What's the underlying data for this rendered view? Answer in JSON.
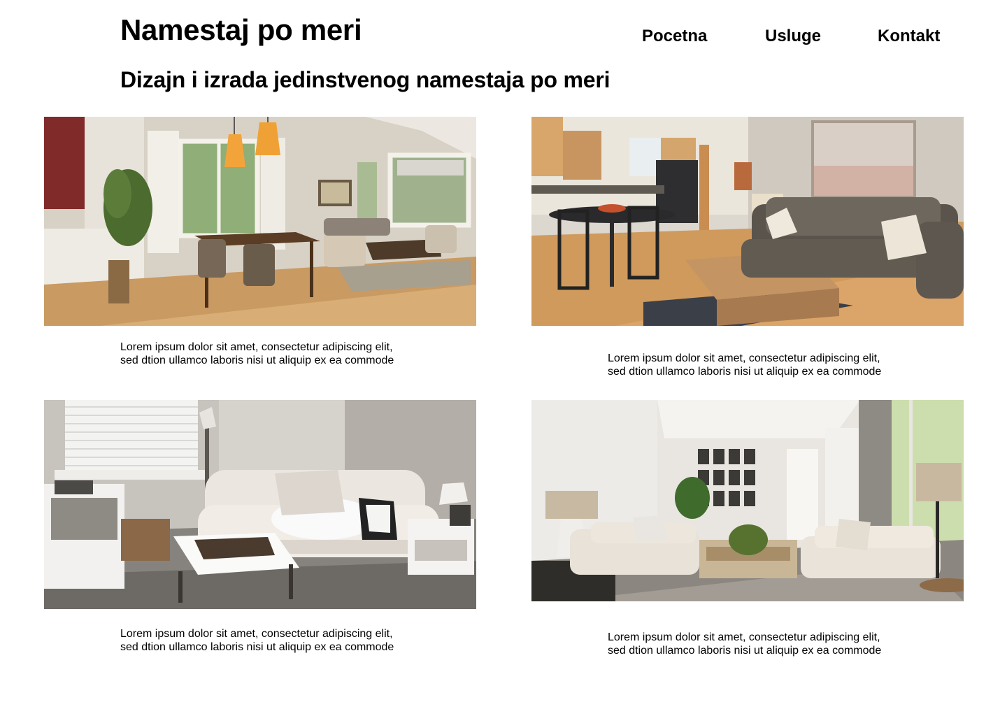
{
  "header": {
    "title": "Namestaj po meri",
    "tagline": "Dizajn i izrada jedinstvenog namestaja po meri"
  },
  "nav": {
    "items": [
      {
        "label": "Pocetna"
      },
      {
        "label": "Usluge"
      },
      {
        "label": "Kontakt"
      }
    ]
  },
  "gallery": {
    "items": [
      {
        "image": "open-plan-dining-living-room",
        "caption": "Lorem ipsum dolor sit amet, consectetur adipiscing elit, sed dtion ullamco laboris nisi ut aliquip ex ea commode"
      },
      {
        "image": "kitchen-and-living-room-with-gray-sofa",
        "caption": "Lorem ipsum dolor sit amet, consectetur adipiscing elit, sed dtion ullamco laboris nisi ut aliquip ex ea commode"
      },
      {
        "image": "white-sofa-living-room",
        "caption": "Lorem ipsum dolor sit amet, consectetur adipiscing elit, sed dtion ullamco laboris nisi ut aliquip ex ea commode"
      },
      {
        "image": "bright-living-room-with-gallery-wall",
        "caption": "Lorem ipsum dolor sit amet, consectetur adipiscing elit, sed dtion ullamco laboris nisi ut aliquip ex ea commode"
      }
    ]
  },
  "colors": {
    "text": "#000000",
    "background": "#ffffff"
  }
}
